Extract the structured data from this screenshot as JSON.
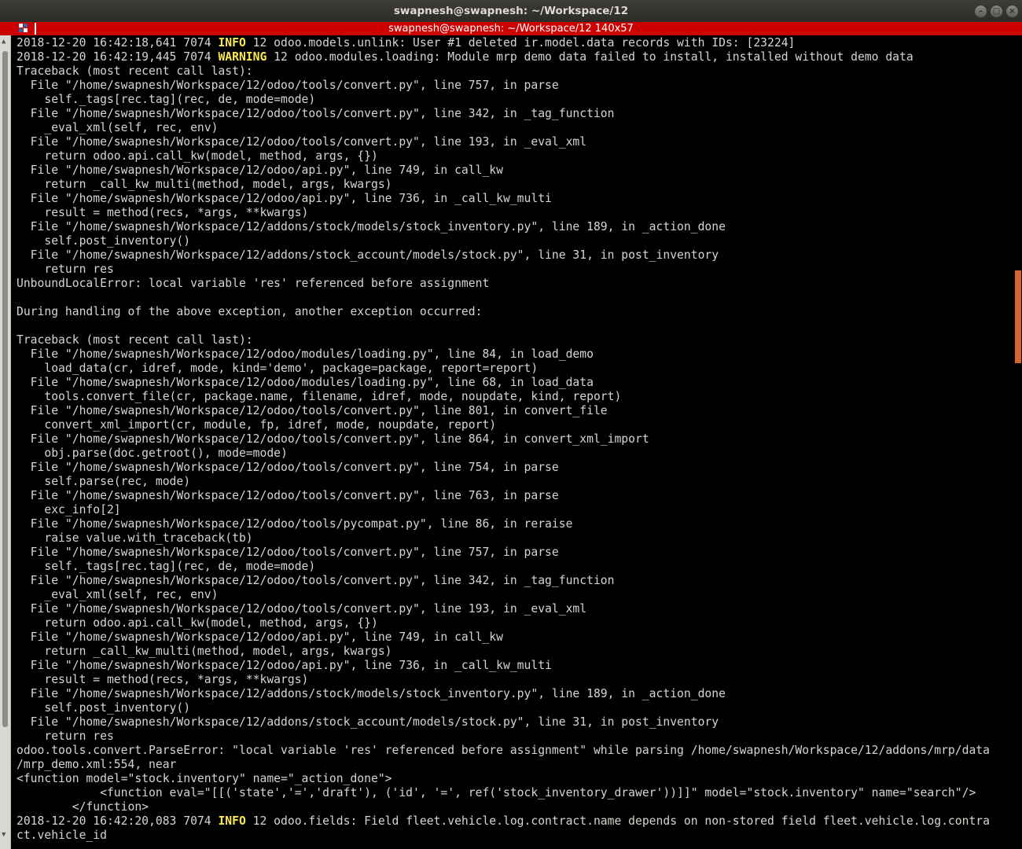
{
  "window": {
    "title": "swapnesh@swapnesh: ~/Workspace/12",
    "tab_title": "swapnesh@swapnesh: ~/Workspace/12 140x57",
    "accent_color": "#cc0000",
    "controls": [
      "minimize-icon",
      "maximize-icon",
      "close-icon"
    ]
  },
  "terminal": {
    "lines": [
      {
        "pre": "2018-12-20 16:42:18,641 7074 ",
        "level": "INFO",
        "post": " 12 odoo.models.unlink: User #1 deleted ir.model.data records with IDs: [23224]"
      },
      {
        "pre": "2018-12-20 16:42:19,445 7074 ",
        "level": "WARNING",
        "post": " 12 odoo.modules.loading: Module mrp demo data failed to install, installed without demo data"
      },
      {
        "text": "Traceback (most recent call last):"
      },
      {
        "text": "  File \"/home/swapnesh/Workspace/12/odoo/tools/convert.py\", line 757, in parse"
      },
      {
        "text": "    self._tags[rec.tag](rec, de, mode=mode)"
      },
      {
        "text": "  File \"/home/swapnesh/Workspace/12/odoo/tools/convert.py\", line 342, in _tag_function"
      },
      {
        "text": "    _eval_xml(self, rec, env)"
      },
      {
        "text": "  File \"/home/swapnesh/Workspace/12/odoo/tools/convert.py\", line 193, in _eval_xml"
      },
      {
        "text": "    return odoo.api.call_kw(model, method, args, {})"
      },
      {
        "text": "  File \"/home/swapnesh/Workspace/12/odoo/api.py\", line 749, in call_kw"
      },
      {
        "text": "    return _call_kw_multi(method, model, args, kwargs)"
      },
      {
        "text": "  File \"/home/swapnesh/Workspace/12/odoo/api.py\", line 736, in _call_kw_multi"
      },
      {
        "text": "    result = method(recs, *args, **kwargs)"
      },
      {
        "text": "  File \"/home/swapnesh/Workspace/12/addons/stock/models/stock_inventory.py\", line 189, in _action_done"
      },
      {
        "text": "    self.post_inventory()"
      },
      {
        "text": "  File \"/home/swapnesh/Workspace/12/addons/stock_account/models/stock.py\", line 31, in post_inventory"
      },
      {
        "text": "    return res"
      },
      {
        "text": "UnboundLocalError: local variable 'res' referenced before assignment"
      },
      {
        "text": ""
      },
      {
        "text": "During handling of the above exception, another exception occurred:"
      },
      {
        "text": ""
      },
      {
        "text": "Traceback (most recent call last):"
      },
      {
        "text": "  File \"/home/swapnesh/Workspace/12/odoo/modules/loading.py\", line 84, in load_demo"
      },
      {
        "text": "    load_data(cr, idref, mode, kind='demo', package=package, report=report)"
      },
      {
        "text": "  File \"/home/swapnesh/Workspace/12/odoo/modules/loading.py\", line 68, in load_data"
      },
      {
        "text": "    tools.convert_file(cr, package.name, filename, idref, mode, noupdate, kind, report)"
      },
      {
        "text": "  File \"/home/swapnesh/Workspace/12/odoo/tools/convert.py\", line 801, in convert_file"
      },
      {
        "text": "    convert_xml_import(cr, module, fp, idref, mode, noupdate, report)"
      },
      {
        "text": "  File \"/home/swapnesh/Workspace/12/odoo/tools/convert.py\", line 864, in convert_xml_import"
      },
      {
        "text": "    obj.parse(doc.getroot(), mode=mode)"
      },
      {
        "text": "  File \"/home/swapnesh/Workspace/12/odoo/tools/convert.py\", line 754, in parse"
      },
      {
        "text": "    self.parse(rec, mode)"
      },
      {
        "text": "  File \"/home/swapnesh/Workspace/12/odoo/tools/convert.py\", line 763, in parse"
      },
      {
        "text": "    exc_info[2]"
      },
      {
        "text": "  File \"/home/swapnesh/Workspace/12/odoo/tools/pycompat.py\", line 86, in reraise"
      },
      {
        "text": "    raise value.with_traceback(tb)"
      },
      {
        "text": "  File \"/home/swapnesh/Workspace/12/odoo/tools/convert.py\", line 757, in parse"
      },
      {
        "text": "    self._tags[rec.tag](rec, de, mode=mode)"
      },
      {
        "text": "  File \"/home/swapnesh/Workspace/12/odoo/tools/convert.py\", line 342, in _tag_function"
      },
      {
        "text": "    _eval_xml(self, rec, env)"
      },
      {
        "text": "  File \"/home/swapnesh/Workspace/12/odoo/tools/convert.py\", line 193, in _eval_xml"
      },
      {
        "text": "    return odoo.api.call_kw(model, method, args, {})"
      },
      {
        "text": "  File \"/home/swapnesh/Workspace/12/odoo/api.py\", line 749, in call_kw"
      },
      {
        "text": "    return _call_kw_multi(method, model, args, kwargs)"
      },
      {
        "text": "  File \"/home/swapnesh/Workspace/12/odoo/api.py\", line 736, in _call_kw_multi"
      },
      {
        "text": "    result = method(recs, *args, **kwargs)"
      },
      {
        "text": "  File \"/home/swapnesh/Workspace/12/addons/stock/models/stock_inventory.py\", line 189, in _action_done"
      },
      {
        "text": "    self.post_inventory()"
      },
      {
        "text": "  File \"/home/swapnesh/Workspace/12/addons/stock_account/models/stock.py\", line 31, in post_inventory"
      },
      {
        "text": "    return res"
      },
      {
        "text": "odoo.tools.convert.ParseError: \"local variable 'res' referenced before assignment\" while parsing /home/swapnesh/Workspace/12/addons/mrp/data"
      },
      {
        "text": "/mrp_demo.xml:554, near"
      },
      {
        "text": "<function model=\"stock.inventory\" name=\"_action_done\">"
      },
      {
        "text": "            <function eval=\"[[('state','=','draft'), ('id', '=', ref('stock_inventory_drawer'))]]\" model=\"stock.inventory\" name=\"search\"/>"
      },
      {
        "text": "        </function>"
      },
      {
        "pre": "2018-12-20 16:42:20,083 7074 ",
        "level": "INFO",
        "post": " 12 odoo.fields: Field fleet.vehicle.log.contract.name depends on non-stored field fleet.vehicle.log.contra"
      },
      {
        "text": "ct.vehicle_id"
      }
    ]
  }
}
